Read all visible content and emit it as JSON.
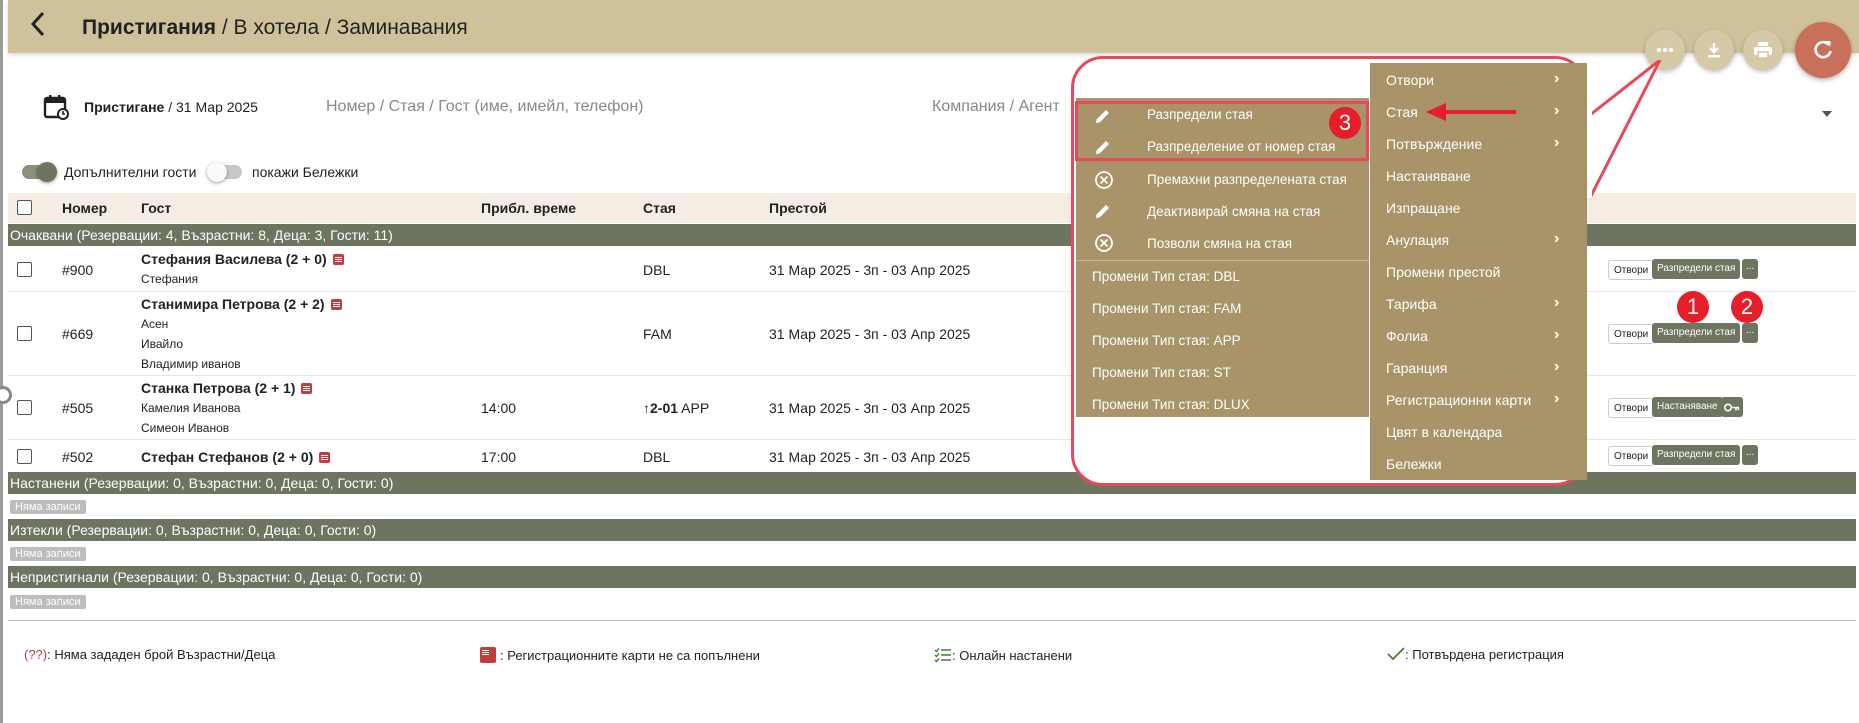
{
  "header": {
    "breadcrumb": [
      "Пристигания",
      "В хотела",
      "Заминавания"
    ],
    "separator": "/",
    "refresh_color": "#c9705a"
  },
  "filters": {
    "date_label": "Пристигане",
    "date_value": "/ 31 Мар 2025",
    "search_placeholder": "Номер / Стая / Гост (име, имейл, телефон)",
    "company_placeholder": "Компания / Агент",
    "toggle_extra_guests": "Допълнителни гости",
    "toggle_notes": "покажи Бележки"
  },
  "table": {
    "columns": [
      "Номер",
      "Гост",
      "Прибл. време",
      "Стая",
      "Престой"
    ],
    "groups": [
      "Очаквани (Резервации: 4, Възрастни: 8, Деца: 3, Гости: 11)",
      "Настанени (Резервации: 0, Възрастни: 0, Деца: 0, Гости: 0)",
      "Изтекли (Резервации: 0, Възрастни: 0, Деца: 0, Гости: 0)",
      "Непристигнали (Резервации: 0, Възрастни: 0, Деца: 0, Гости: 0)"
    ],
    "no_records": "Няма записи",
    "rows": [
      {
        "number": "#900",
        "guest": "Стефания Василева (2 + 0)",
        "subs": [
          "Стефания"
        ],
        "time": "",
        "room_no": "",
        "room": "DBL",
        "stay": "31 Мар 2025 - 3п - 03 Апр 2025",
        "btn_open": "Отвори",
        "btn_action": "Разпредели стая",
        "btn_more": "..."
      },
      {
        "number": "#669",
        "guest": "Станимира Петрова (2 + 2)",
        "subs": [
          "Асен",
          "Ивайло",
          "Владимир иванов"
        ],
        "time": "",
        "room_no": "",
        "room": "FAM",
        "stay": "31 Мар 2025 - 3п - 03 Апр 2025",
        "btn_open": "Отвори",
        "btn_action": "Разпредели стая",
        "btn_more": "..."
      },
      {
        "number": "#505",
        "guest": "Станка Петрова (2 + 1)",
        "subs": [
          "Камелия Иванова",
          "Симеон Иванов"
        ],
        "time": "14:00",
        "room_no": "2-01",
        "room": "APP",
        "stay": "31 Мар 2025 - 3п - 03 Апр 2025",
        "btn_open": "Отвори",
        "btn_action": "Настаняване",
        "btn_more": ""
      },
      {
        "number": "#502",
        "guest": "Стефан Стефанов (2 + 0)",
        "subs": [],
        "time": "17:00",
        "room_no": "",
        "room": "DBL",
        "stay": "31 Мар 2025 - 3п - 03 Апр 2025",
        "btn_open": "Отвори",
        "btn_action": "Разпредели стая",
        "btn_more": "..."
      }
    ]
  },
  "menu": {
    "main": [
      "Отвори",
      "Стая",
      "Потвърждение",
      "Настаняване",
      "Изпращане",
      "Анулация",
      "Промени престой",
      "Тарифа",
      "Фолиа",
      "Гаранция",
      "Регистрационни карти",
      "Цвят в календара",
      "Бележки"
    ],
    "room_submenu": [
      "Разпредели стая",
      "Разпределение от номер стая",
      "Премахни разпределената стая",
      "Деактивирай смяна на стая",
      "Позволи смяна на стая"
    ],
    "room_types": [
      "Промени Тип стая: DBL",
      "Промени Тип стая: FAM",
      "Промени Тип стая: APP",
      "Промени Тип стая: ST",
      "Промени Тип стая: DLUX"
    ],
    "accent": "#e8495a",
    "background": "#a89468"
  },
  "annotations": [
    "1",
    "2",
    "3"
  ],
  "legend": {
    "missing_prefix": "(??)",
    "missing": ": Няма зададен брой Възрастни/Деца",
    "cards": ": Регистрационните карти не са попълнени",
    "online": ": Онлайн настанени",
    "confirmed": ": Потвърдена регистрация"
  }
}
